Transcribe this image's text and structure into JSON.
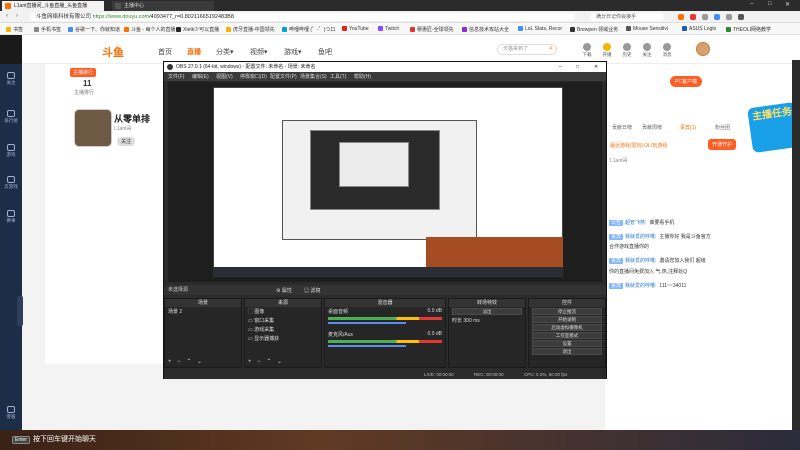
{
  "browser": {
    "tabs": [
      {
        "label": "L1ant直播间_斗鱼直播_头鱼直播",
        "active": true,
        "color": "#ff6f00"
      },
      {
        "label": "主播中心",
        "active": false,
        "color": "#555"
      }
    ],
    "window_controls": [
      "–",
      "□",
      "✕"
    ],
    "url_prefix": "斗鱼网络科技有限公司",
    "url_host": "https://www.douyu.com",
    "url_path": "/4093477_r=0.80211665192483B8",
    "search_placeholder": "满分日记你会接手",
    "bookmarks": [
      {
        "label": "书签",
        "color": "#f5b400"
      },
      {
        "label": "手机书签",
        "color": "#888"
      },
      {
        "label": "谷歌一下、你就知道",
        "color": "#3f8ef5"
      },
      {
        "label": "斗鱼 - 每个人的直播",
        "color": "#ff6f00"
      },
      {
        "label": "Xtelk少可以直播",
        "color": "#222"
      },
      {
        "label": "虎牙直播-中国领先",
        "color": "#f5b400"
      },
      {
        "label": "哔哩哔哩 (゜-゜)つ口",
        "color": "#00a1d6"
      },
      {
        "label": "YouTube",
        "color": "#e62117"
      },
      {
        "label": "Twitch",
        "color": "#9146ff"
      },
      {
        "label": "穆惠匠-全球领先",
        "color": "#d33"
      },
      {
        "label": "信息技术攻站大全",
        "color": "#8a2be2"
      },
      {
        "label": "LoL Stats, Recor",
        "color": "#3f8ef5"
      },
      {
        "label": "Brewpen 领域业务",
        "color": "#333"
      },
      {
        "label": "Mouse Sensitivi",
        "color": "#555"
      },
      {
        "label": "ASUS Login",
        "color": "#1560bd"
      },
      {
        "label": "THEOLI网络教学",
        "color": "#2a8a2a"
      }
    ]
  },
  "site": {
    "logo": "斗鱼",
    "nav": [
      {
        "label": "首页",
        "active": false
      },
      {
        "label": "直播",
        "active": true
      },
      {
        "label": "分类▾",
        "active": false
      },
      {
        "label": "视频▾",
        "active": false
      },
      {
        "label": "游戏▾",
        "active": false
      },
      {
        "label": "鱼吧",
        "active": false
      }
    ],
    "search_placeholder": "天猫来到了",
    "header_icons": [
      {
        "label": "下载",
        "color": "#999"
      },
      {
        "label": "开播",
        "color": "#f5b400"
      },
      {
        "label": "历史",
        "color": "#999"
      },
      {
        "label": "关注",
        "color": "#999"
      },
      {
        "label": "消息",
        "color": "#999"
      }
    ]
  },
  "left_nav": [
    "关注",
    "排行榜",
    "游戏",
    "云游戏",
    "赛事",
    "客服"
  ],
  "streamer": {
    "rank_badge": "主播排行",
    "rank_num": "11",
    "rank_label": "主播排行",
    "name": "从零单排",
    "id": "L1ant哥",
    "follow": "关注"
  },
  "obs": {
    "title": "OBS 27.0.1 (64-bit, windows) - 配置文件: 未命名 - 场景: 未命名",
    "menu": [
      "文件(F)",
      "编辑(E)",
      "视图(V)",
      "停靠窗口(D)",
      "配置文件(P)",
      "场景集合(S)",
      "工具(T)",
      "帮助(H)"
    ],
    "selection": "未选择源",
    "props_btn": "⚙ 属性",
    "filter_btn": "▤ 滤镜",
    "docks": {
      "scenes": {
        "title": "场景",
        "items": [
          "场景 2"
        ]
      },
      "sources": {
        "title": "来源",
        "items": [
          "⬚ 图像",
          "▭ 窗口采集",
          "▭ 游戏采集",
          "▭ 显示器捕获"
        ]
      },
      "mixer": {
        "title": "混音器",
        "tracks": [
          {
            "name": "桌面音频",
            "db": "0.0 dB"
          },
          {
            "name": "麦克风/Aux",
            "db": "0.0 dB"
          }
        ]
      },
      "transitions": {
        "title": "转场特效",
        "type": "淡出",
        "duration_label": "时长",
        "duration": "300 ms"
      },
      "controls": {
        "title": "控件",
        "buttons": [
          "停止推流",
          "开始录制",
          "启动虚拟摄像机",
          "工作室模式",
          "设置",
          "退出"
        ]
      }
    },
    "footer_glyphs": "+ − ⌃ ⌄",
    "status": [
      {
        "label": "LIVE: 00:00:00"
      },
      {
        "label": "REC: 00:00:00"
      },
      {
        "label": "CPU: 0.3%, 60.00 fps"
      }
    ]
  },
  "right_panel": {
    "pc_client": "PC客户端",
    "promo": "主播任务",
    "tabs": [
      {
        "label": "贡献日榜",
        "active": false
      },
      {
        "label": "贡献周榜",
        "active": false
      },
      {
        "label": "贵宾(1)",
        "active": true
      },
      {
        "label": "粉丝团",
        "active": false
      }
    ],
    "notice": "最近游戏/爱玩LOL/玩游戏",
    "notice_sub": "L1ant哥",
    "open_guard": "开通守护",
    "chat": [
      {
        "tag": "公告",
        "user": "超管飞燕:",
        "text": "谁要看手机"
      },
      {
        "tag": "贵宾",
        "user": "我就爱的呼噜:",
        "text": "主播你好 我是斗鱼官方"
      },
      {
        "tag": "",
        "user": "",
        "text": "合作游戏直播你的"
      },
      {
        "tag": "贵宾",
        "user": "我就爱的呼噜:",
        "text": "邀请您加入我们 超级"
      },
      {
        "tag": "",
        "user": "",
        "text": "你的直播间免费加入 气,热,注释处Q"
      },
      {
        "tag": "贵宾",
        "user": "我就爱的呼噜:",
        "text": "111~~34011"
      }
    ]
  },
  "bottom": {
    "enter_key": "Enter",
    "hint": "按下回车键开始聊天"
  }
}
